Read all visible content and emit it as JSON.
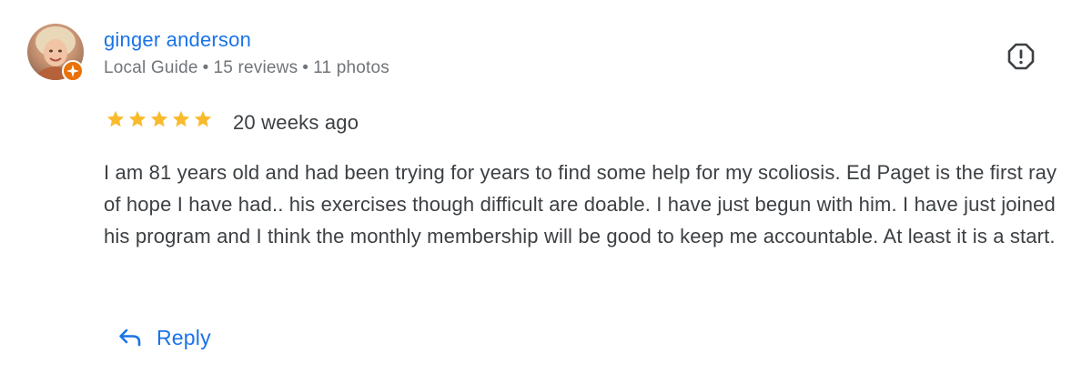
{
  "review": {
    "author": {
      "name": "ginger anderson",
      "badge": "Local Guide",
      "reviews": "15 reviews",
      "photos": "11 photos",
      "separator": "•"
    },
    "rating": 5,
    "rating_max": 5,
    "age": "20 weeks ago",
    "text": "I am 81 years old and had been trying for years to find some help for my scoliosis. Ed Paget is the first ray of hope I have had.. his exercises though difficult are doable. I have just begun with him. I have just joined his program and I think the monthly membership will be good to keep me accountable. At least it is a start.",
    "actions": {
      "reply_label": "Reply"
    }
  },
  "icons": {
    "report": "report-flag-icon",
    "reply": "reply-arrow-icon",
    "badge": "local-guide-star-icon",
    "star": "star-icon"
  },
  "colors": {
    "link_blue": "#1a73e8",
    "star_gold": "#f9bb2d",
    "meta_gray": "#70757a",
    "body_text": "#3c4043",
    "badge_orange": "#e8710a"
  }
}
